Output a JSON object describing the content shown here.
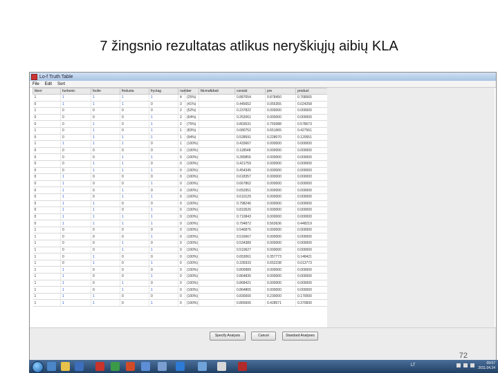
{
  "slide": {
    "title": "7 žingsnio rezultatas atlikus neryškiųjų aibių KLA",
    "page_number": "72"
  },
  "window": {
    "title": "Lo-f Truth Table",
    "menu": [
      "File",
      "Edit",
      "Sort"
    ]
  },
  "table": {
    "columns": [
      "tikeri",
      "funbonic",
      "foolie",
      "findusta",
      "fryctag",
      "number",
      "",
      "fdcmafidrati",
      "consist",
      "pre",
      "product"
    ],
    "rows": [
      [
        "1",
        "1",
        "1",
        "1",
        "1",
        "4",
        "(25%)",
        "",
        "0.887654",
        "0.878450",
        "0.768565"
      ],
      [
        "0",
        "1",
        "1",
        "1",
        "0",
        "3",
        "(41%)",
        "",
        "0.445652",
        "0.055355",
        "0.024258"
      ],
      [
        "1",
        "0",
        "0",
        "0",
        "0",
        "2",
        "(52%)",
        "",
        "0.237822",
        "0.000000",
        "0.000000"
      ],
      [
        "0",
        "0",
        "0",
        "0",
        "1",
        "2",
        "(64%)",
        "",
        "0.252061",
        "0.000000",
        "0.000000"
      ],
      [
        "0",
        "0",
        "1",
        "0",
        "1",
        "2",
        "(75%)",
        "",
        "0.803531",
        "0.759388",
        "0.578673"
      ],
      [
        "1",
        "0",
        "1",
        "0",
        "1",
        "1",
        "(83%)",
        "",
        "0.680752",
        "0.651965",
        "0.427561"
      ],
      [
        "0",
        "0",
        "1",
        "1",
        "1",
        "1",
        "(94%)",
        "",
        "0.528591",
        "0.228070",
        "0.120551"
      ],
      [
        "1",
        "1",
        "1",
        "1",
        "0",
        "1",
        "(100%)",
        "",
        "0.433667",
        "0.000000",
        "0.000000"
      ],
      [
        "0",
        "0",
        "0",
        "0",
        "0",
        "0",
        "(100%)",
        "",
        "0.118548",
        "0.000000",
        "0.000000"
      ],
      [
        "0",
        "0",
        "0",
        "1",
        "1",
        "0",
        "(100%)",
        "",
        "0.280855",
        "0.000000",
        "0.000000"
      ],
      [
        "0",
        "0",
        "1",
        "1",
        "0",
        "0",
        "(100%)",
        "",
        "0.421759",
        "0.000000",
        "0.000000"
      ],
      [
        "0",
        "0",
        "1",
        "1",
        "1",
        "0",
        "(100%)",
        "",
        "0.454345",
        "0.000000",
        "0.000000"
      ],
      [
        "0",
        "1",
        "0",
        "0",
        "0",
        "0",
        "(100%)",
        "",
        "0.618357",
        "0.000000",
        "0.000000"
      ],
      [
        "0",
        "1",
        "0",
        "0",
        "1",
        "0",
        "(100%)",
        "",
        "0.667862",
        "0.000000",
        "0.000000"
      ],
      [
        "0",
        "1",
        "0",
        "1",
        "0",
        "0",
        "(100%)",
        "",
        "0.652951",
        "0.000000",
        "0.000000"
      ],
      [
        "0",
        "1",
        "0",
        "1",
        "1",
        "0",
        "(100%)",
        "",
        "0.610129",
        "0.000000",
        "0.000000"
      ],
      [
        "0",
        "1",
        "1",
        "0",
        "0",
        "0",
        "(100%)",
        "",
        "0.798246",
        "0.000000",
        "0.000000"
      ],
      [
        "0",
        "1",
        "1",
        "0",
        "1",
        "0",
        "(100%)",
        "",
        "0.810526",
        "0.000000",
        "0.000000"
      ],
      [
        "0",
        "1",
        "1",
        "1",
        "1",
        "0",
        "(100%)",
        "",
        "0.710843",
        "0.000000",
        "0.000000"
      ],
      [
        "0",
        "1",
        "1",
        "1",
        "1",
        "0",
        "(100%)",
        "",
        "0.794872",
        "0.563636",
        "0.448219"
      ],
      [
        "1",
        "0",
        "0",
        "0",
        "0",
        "0",
        "(100%)",
        "",
        "0.546875",
        "0.000000",
        "0.000000"
      ],
      [
        "1",
        "0",
        "0",
        "0",
        "1",
        "0",
        "(100%)",
        "",
        "0.516667",
        "0.000000",
        "0.000000"
      ],
      [
        "1",
        "0",
        "0",
        "1",
        "0",
        "0",
        "(100%)",
        "",
        "0.534389",
        "0.000000",
        "0.000000"
      ],
      [
        "1",
        "0",
        "0",
        "1",
        "1",
        "0",
        "(100%)",
        "",
        "0.510627",
        "0.000000",
        "0.000000"
      ],
      [
        "1",
        "0",
        "1",
        "0",
        "0",
        "0",
        "(100%)",
        "",
        "0.653061",
        "0.357773",
        "0.148421"
      ],
      [
        "1",
        "0",
        "1",
        "0",
        "1",
        "0",
        "(100%)",
        "",
        "0.335933",
        "0.652238",
        "0.013773"
      ],
      [
        "1",
        "1",
        "0",
        "0",
        "0",
        "0",
        "(100%)",
        "",
        "0.800989",
        "0.000000",
        "0.000000"
      ],
      [
        "1",
        "1",
        "0",
        "0",
        "1",
        "0",
        "(100%)",
        "",
        "0.864835",
        "0.000000",
        "0.000000"
      ],
      [
        "1",
        "1",
        "0",
        "1",
        "0",
        "0",
        "(100%)",
        "",
        "0.868421",
        "0.000000",
        "0.000000"
      ],
      [
        "1",
        "1",
        "0",
        "1",
        "1",
        "0",
        "(100%)",
        "",
        "0.864865",
        "0.000000",
        "0.000000"
      ],
      [
        "1",
        "1",
        "1",
        "0",
        "0",
        "0",
        "(100%)",
        "",
        "0.830000",
        "0.230000",
        "0.170000"
      ],
      [
        "1",
        "1",
        "1",
        "0",
        "1",
        "0",
        "(100%)",
        "",
        "0.865606",
        "0.428571",
        "0.370830"
      ]
    ]
  },
  "buttons": {
    "specify": "Specify Analysis",
    "cancel": "Cancel",
    "standard": "Standard Analyses"
  },
  "taskbar": {
    "lang": "LT",
    "time": "09:57",
    "date": "2011.04.24"
  }
}
